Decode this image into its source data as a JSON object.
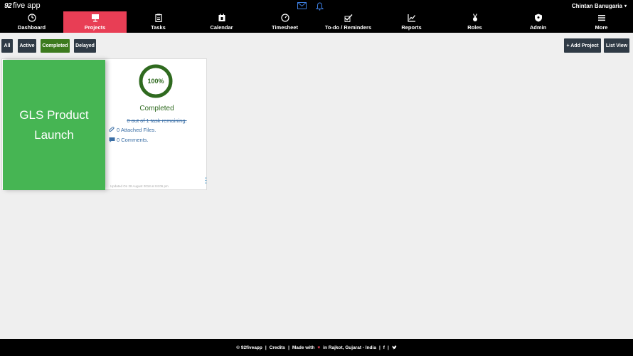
{
  "app": {
    "brand_number": "92",
    "brand_name": "five app"
  },
  "header": {
    "user_name": "Chintan Banugaria",
    "user_caret": "▾"
  },
  "nav": {
    "items": [
      {
        "label": "Dashboard",
        "icon": "dashboard-icon"
      },
      {
        "label": "Projects",
        "icon": "projects-icon",
        "active": true
      },
      {
        "label": "Tasks",
        "icon": "tasks-icon"
      },
      {
        "label": "Calendar",
        "icon": "calendar-icon"
      },
      {
        "label": "Timesheet",
        "icon": "timesheet-icon"
      },
      {
        "label": "To-do / Reminders",
        "icon": "todo-icon"
      },
      {
        "label": "Reports",
        "icon": "reports-icon"
      },
      {
        "label": "Roles",
        "icon": "roles-icon"
      },
      {
        "label": "Admin",
        "icon": "admin-icon"
      },
      {
        "label": "More",
        "icon": "more-icon"
      }
    ],
    "active_color": "#e83e55"
  },
  "filters": {
    "all": "All",
    "active": "Active",
    "completed": "Completed",
    "delayed": "Delayed",
    "selected": "Completed",
    "selected_color": "#3c7a1e"
  },
  "actions": {
    "add_project": "+ Add Project",
    "list_view": "List View"
  },
  "project": {
    "name": "GLS Product Launch",
    "progress_percent": 100,
    "progress_label": "100%",
    "status": "Completed",
    "tasks_remaining": "0 out of 1 task remaining.",
    "attached_files": "0 Attached Files.",
    "comments": "0 Comments.",
    "updated": "Updated On 28 August 2018 at 04:06 pm",
    "cover_color": "#46b553",
    "ring_color": "#2f6a1f"
  },
  "footer": {
    "copyright": "© 92fiveapp",
    "credits": "Credits",
    "made_with": "Made with",
    "location": "in Rajkot, Gujarat - India",
    "facebook": "f",
    "twitter": "🐦"
  }
}
